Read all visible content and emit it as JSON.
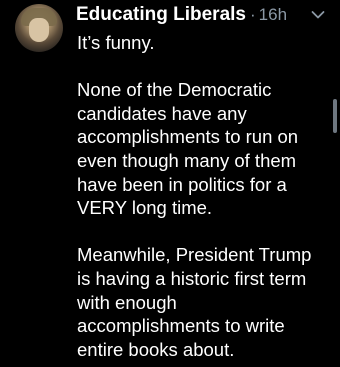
{
  "tweet": {
    "author_name": "Educating Liberals",
    "separator": "·",
    "timestamp": "16h",
    "lines": [
      "It’s funny.",
      "",
      "None of the Democratic",
      "candidates have any",
      "accomplishments to run on",
      "even though many of them",
      "have been in politics for a",
      "VERY long time.",
      "",
      "Meanwhile, President Trump",
      "is having a historic first term",
      "with enough",
      "accomplishments to write",
      "entire books about."
    ]
  },
  "icons": {
    "avatar": "profile-photo",
    "menu": "chevron-down-icon"
  },
  "colors": {
    "background": "#000000",
    "text": "#ffffff",
    "secondary_text": "#8b98a5",
    "scrollbar": "#6e7780"
  }
}
